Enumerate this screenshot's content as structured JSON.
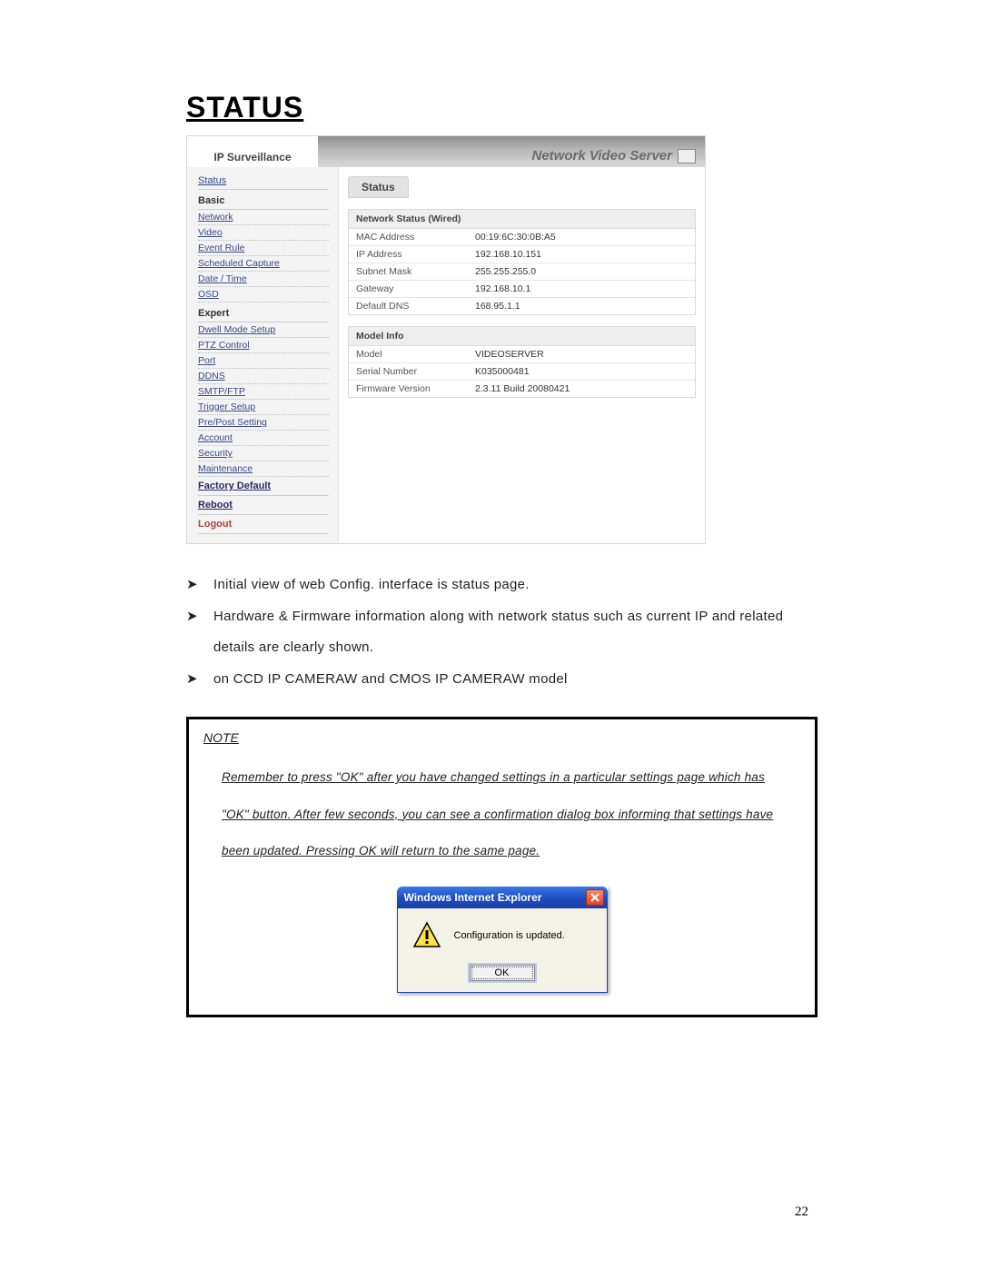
{
  "heading": "STATUS",
  "page_number": "22",
  "ui": {
    "sidebar_title": "IP Surveillance",
    "banner_title": "Network Video Server",
    "main_tab": "Status",
    "nav": {
      "status": "Status",
      "sections": {
        "basic": "Basic",
        "expert": "Expert"
      },
      "basic_items": [
        "Network",
        "Video",
        "Event Rule",
        "Scheduled Capture",
        "Date / Time",
        "OSD"
      ],
      "expert_items": [
        "Dwell Mode Setup",
        "PTZ Control",
        "Port",
        "DDNS",
        "SMTP/FTP",
        "Trigger Setup",
        "Pre/Post Setting",
        "Account",
        "Security",
        "Maintenance"
      ],
      "actions": {
        "factory_default": "Factory Default",
        "reboot": "Reboot",
        "logout": "Logout"
      }
    },
    "panels": [
      {
        "title": "Network Status (Wired)",
        "rows": [
          {
            "k": "MAC Address",
            "v": "00:19:6C:30:0B:A5"
          },
          {
            "k": "IP Address",
            "v": "192.168.10.151"
          },
          {
            "k": "Subnet Mask",
            "v": "255.255.255.0"
          },
          {
            "k": "Gateway",
            "v": "192.168.10.1"
          },
          {
            "k": "Default DNS",
            "v": "168.95.1.1"
          }
        ]
      },
      {
        "title": "Model Info",
        "rows": [
          {
            "k": "Model",
            "v": "VIDEOSERVER"
          },
          {
            "k": "Serial Number",
            "v": "K035000481"
          },
          {
            "k": "Firmware Version",
            "v": "2.3.11 Build 20080421"
          }
        ]
      }
    ]
  },
  "bullets": [
    "Initial view of web Config. interface is status page.",
    "Hardware & Firmware information along with network status such as current IP and related details are clearly shown.",
    "on CCD IP CAMERAW and CMOS IP CAMERAW model"
  ],
  "note": {
    "title": "NOTE",
    "body": "Remember to press \"OK\" after you have changed settings in a particular settings page which has \"OK\" button. After few seconds, you can see a confirmation dialog box informing that settings have been updated. Pressing OK will return to the same page."
  },
  "dialog": {
    "title": "Windows Internet Explorer",
    "message": "Configuration is updated.",
    "ok": "OK"
  },
  "bullet_glyph": "➤"
}
